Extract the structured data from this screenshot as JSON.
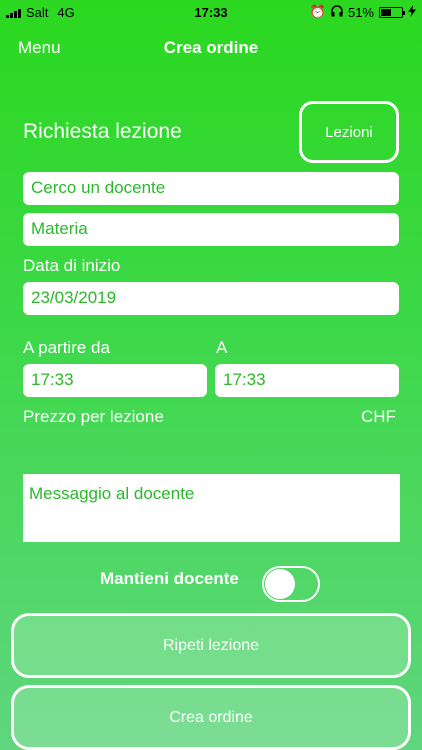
{
  "status_bar": {
    "carrier": "Salt",
    "network": "4G",
    "time": "17:33",
    "battery_percent": "51%",
    "battery_level": 0.51,
    "icons": [
      "signal-icon",
      "alarm-icon",
      "headphones-icon",
      "battery-icon",
      "charging-icon"
    ]
  },
  "nav": {
    "menu_label": "Menu",
    "title": "Crea ordine"
  },
  "form": {
    "heading": "Richiesta lezione",
    "lessons_button": "Lezioni",
    "teacher_field": "Cerco un docente",
    "subject_field": "Materia",
    "start_date_label": "Data di inizio",
    "start_date_value": "23/03/2019",
    "from_label": "A partire da",
    "to_label": "A",
    "from_time": "17:33",
    "to_time": "17:33",
    "price_label": "Prezzo per lezione",
    "currency": "CHF",
    "message_placeholder": "Messaggio al docente",
    "keep_teacher_label": "Mantieni docente",
    "keep_teacher_on": false
  },
  "actions": {
    "repeat_label": "Ripeti lezione",
    "create_label": "Crea ordine"
  },
  "colors": {
    "primary_green": "#2bd81f",
    "text_green": "#2bb82b",
    "white": "#ffffff"
  }
}
